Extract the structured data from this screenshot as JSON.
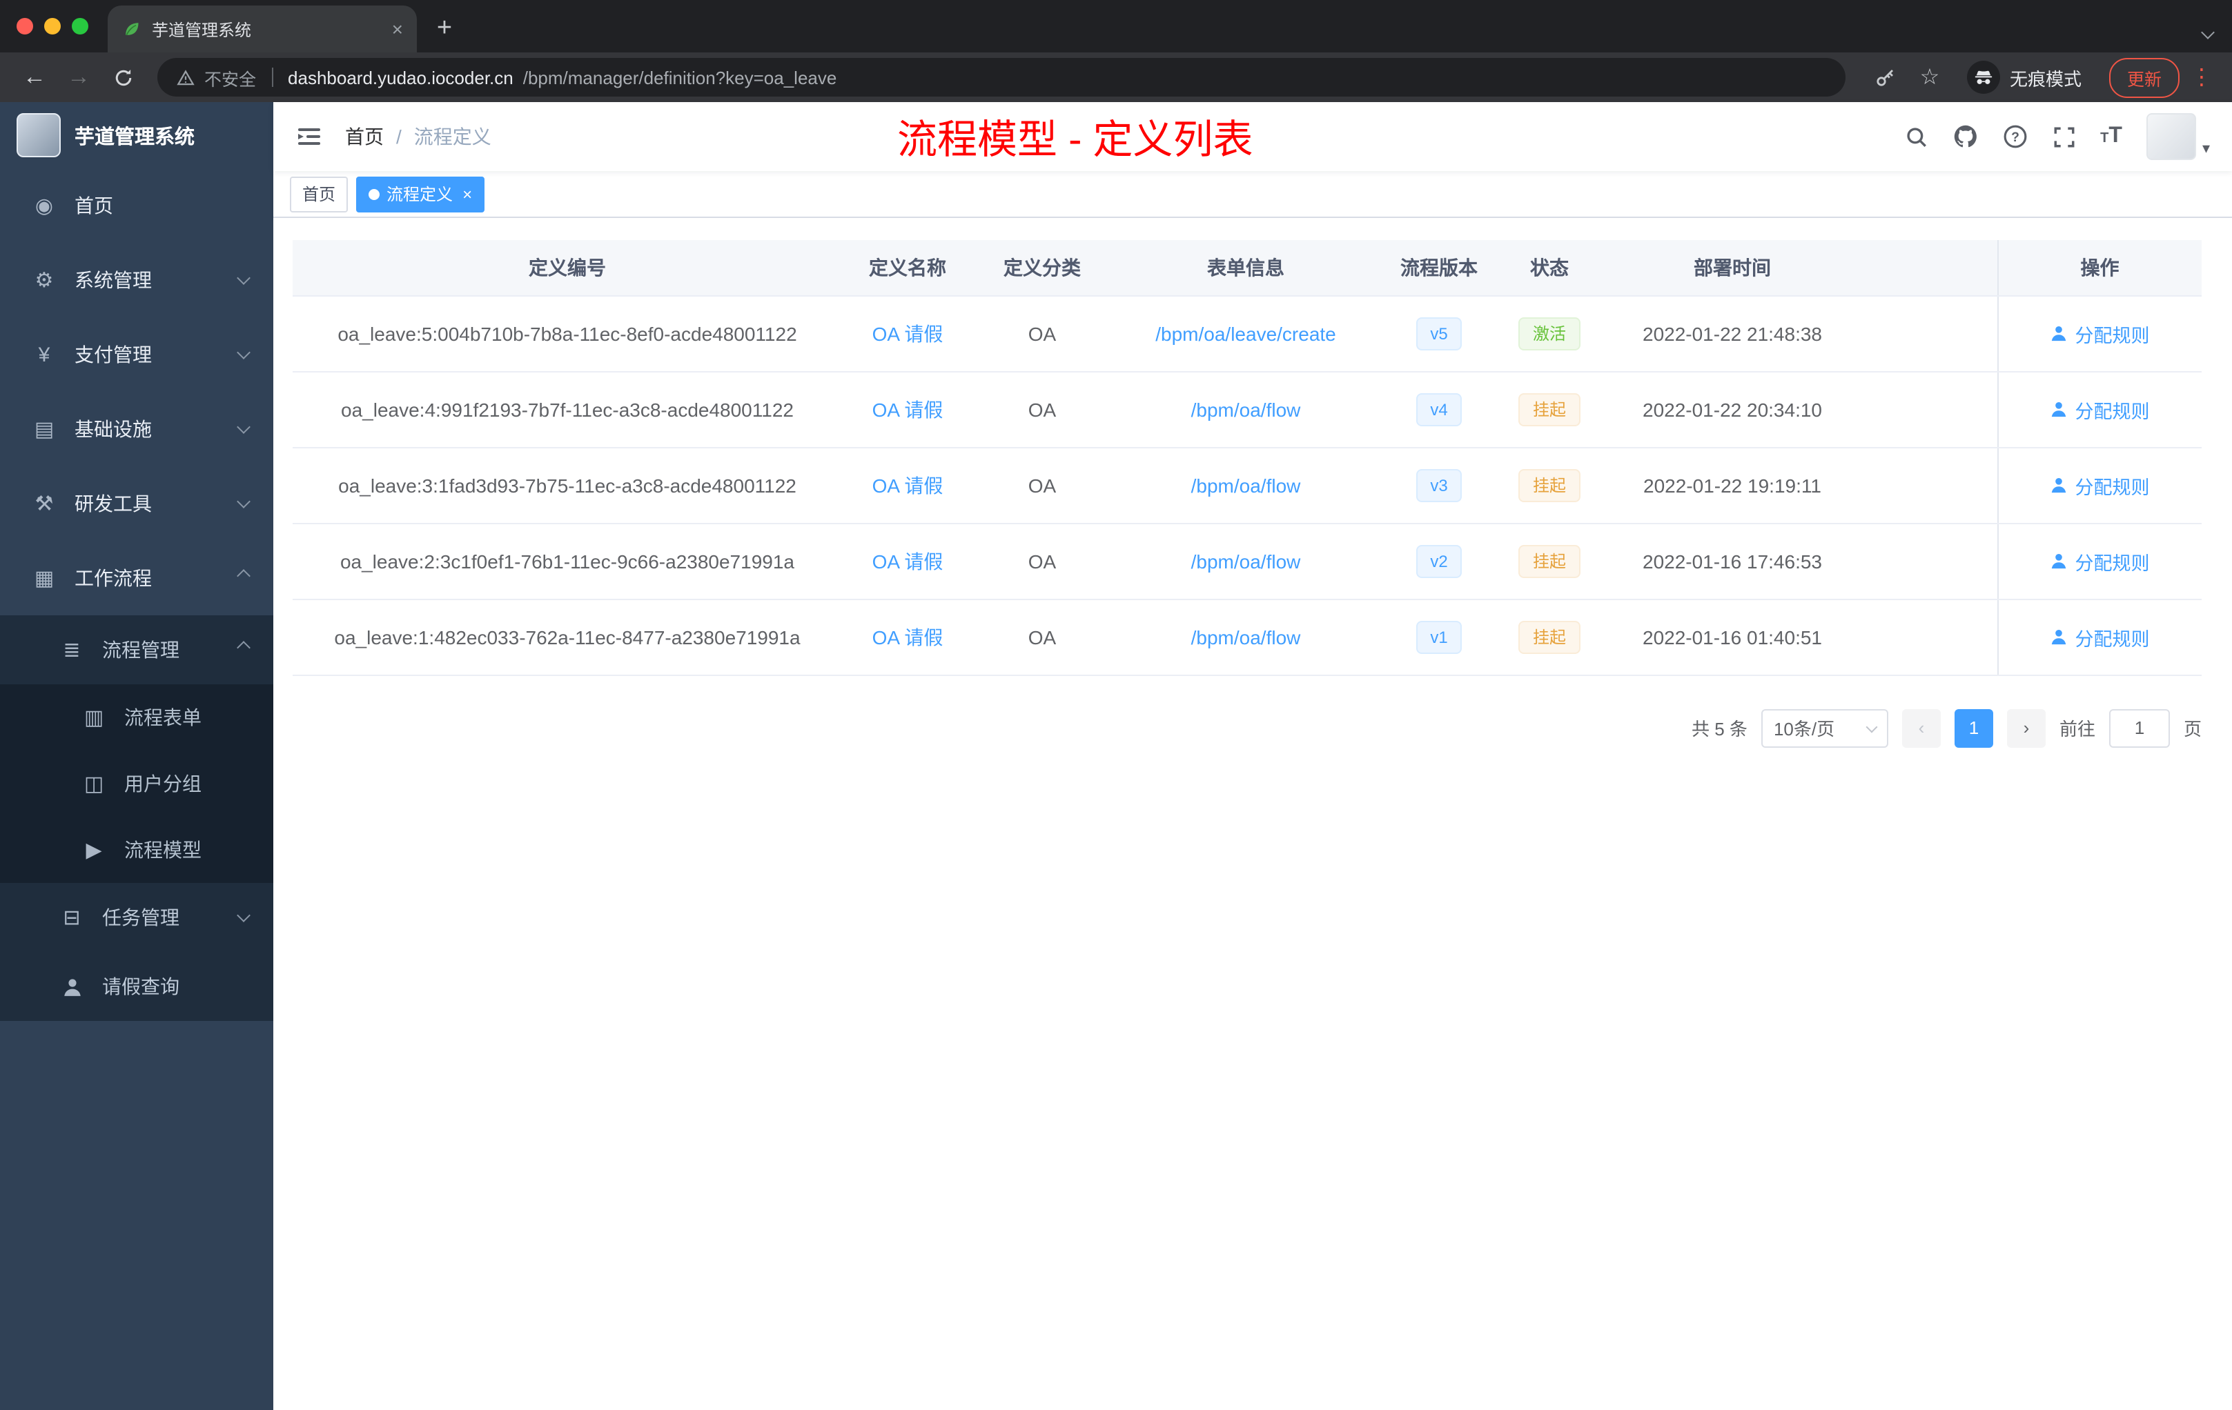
{
  "colors": {
    "accent": "#409eff",
    "overlay_title_red": "#ff0000",
    "success_text": "#67c23a",
    "warning_text": "#e6a23c",
    "update_chip": "#f05545",
    "sidebar_bg": "#304156"
  },
  "browser": {
    "tab_title": "芋道管理系统",
    "security_label": "不安全",
    "url_domain": "dashboard.yudao.iocoder.cn",
    "url_path": "/bpm/manager/definition?key=oa_leave",
    "incognito_label": "无痕模式",
    "update_label": "更新"
  },
  "sidebar": {
    "logo_title": "芋道管理系统",
    "items": [
      {
        "key": "home",
        "label": "首页",
        "depth": 1,
        "icon": "dashboard-icon",
        "chevron": ""
      },
      {
        "key": "system-management",
        "label": "系统管理",
        "depth": 1,
        "icon": "gear-icon",
        "chevron": "down"
      },
      {
        "key": "payment-management",
        "label": "支付管理",
        "depth": 1,
        "icon": "yen-icon",
        "chevron": "down"
      },
      {
        "key": "infrastructure",
        "label": "基础设施",
        "depth": 1,
        "icon": "infrastructure-icon",
        "chevron": "down"
      },
      {
        "key": "dev-tools",
        "label": "研发工具",
        "depth": 1,
        "icon": "tools-icon",
        "chevron": "down"
      },
      {
        "key": "workflow",
        "label": "工作流程",
        "depth": 1,
        "icon": "workflow-icon",
        "chevron": "up"
      },
      {
        "key": "process-management",
        "label": "流程管理",
        "depth": 2,
        "icon": "process-management-icon",
        "chevron": "up"
      },
      {
        "key": "process-form",
        "label": "流程表单",
        "depth": 3,
        "icon": "form-icon",
        "chevron": ""
      },
      {
        "key": "user-group",
        "label": "用户分组",
        "depth": 3,
        "icon": "user-group-icon",
        "chevron": ""
      },
      {
        "key": "process-model",
        "label": "流程模型",
        "depth": 3,
        "icon": "process-model-icon",
        "chevron": ""
      },
      {
        "key": "task-management",
        "label": "任务管理",
        "depth": 2,
        "icon": "task-management-icon",
        "chevron": "down"
      },
      {
        "key": "leave-query",
        "label": "请假查询",
        "depth": 2,
        "icon": "person-icon",
        "chevron": ""
      }
    ]
  },
  "header": {
    "breadcrumb": {
      "home": "首页",
      "separator": "/",
      "current": "流程定义"
    },
    "overlay_title": "流程模型 - 定义列表"
  },
  "tags": {
    "home": "首页",
    "active": "流程定义",
    "close": "×"
  },
  "table": {
    "columns": [
      "定义编号",
      "定义名称",
      "定义分类",
      "表单信息",
      "流程版本",
      "状态",
      "部署时间",
      "操作"
    ],
    "action_label": "分配规则",
    "rows": [
      {
        "id": "oa_leave:5:004b710b-7b8a-11ec-8ef0-acde48001122",
        "name": "OA 请假",
        "category": "OA",
        "form": "/bpm/oa/leave/create",
        "version": "v5",
        "status": "激活",
        "status_type": "success",
        "deployed_at": "2022-01-22 21:48:38"
      },
      {
        "id": "oa_leave:4:991f2193-7b7f-11ec-a3c8-acde48001122",
        "name": "OA 请假",
        "category": "OA",
        "form": "/bpm/oa/flow",
        "version": "v4",
        "status": "挂起",
        "status_type": "warning",
        "deployed_at": "2022-01-22 20:34:10"
      },
      {
        "id": "oa_leave:3:1fad3d93-7b75-11ec-a3c8-acde48001122",
        "name": "OA 请假",
        "category": "OA",
        "form": "/bpm/oa/flow",
        "version": "v3",
        "status": "挂起",
        "status_type": "warning",
        "deployed_at": "2022-01-22 19:19:11"
      },
      {
        "id": "oa_leave:2:3c1f0ef1-76b1-11ec-9c66-a2380e71991a",
        "name": "OA 请假",
        "category": "OA",
        "form": "/bpm/oa/flow",
        "version": "v2",
        "status": "挂起",
        "status_type": "warning",
        "deployed_at": "2022-01-16 17:46:53"
      },
      {
        "id": "oa_leave:1:482ec033-762a-11ec-8477-a2380e71991a",
        "name": "OA 请假",
        "category": "OA",
        "form": "/bpm/oa/flow",
        "version": "v1",
        "status": "挂起",
        "status_type": "warning",
        "deployed_at": "2022-01-16 01:40:51"
      }
    ]
  },
  "pagination": {
    "total": "共 5 条",
    "page_size": "10条/页",
    "current_page": "1",
    "goto_label": "前往",
    "goto_value": "1",
    "goto_unit": "页"
  }
}
